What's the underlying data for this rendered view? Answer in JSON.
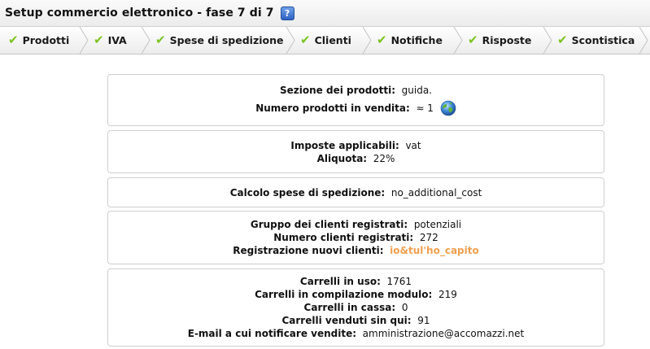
{
  "window": {
    "title": "Setup commercio elettronico - fase 7 di 7",
    "help_icon": "question-icon"
  },
  "steps": [
    {
      "label": "Prodotti",
      "icon": "check-icon"
    },
    {
      "label": "IVA",
      "icon": "check-icon"
    },
    {
      "label": "Spese di spedizione",
      "icon": "check-icon"
    },
    {
      "label": "Clienti",
      "icon": "check-icon"
    },
    {
      "label": "Notifiche",
      "icon": "check-icon"
    },
    {
      "label": "Risposte",
      "icon": "check-icon"
    },
    {
      "label": "Scontistica",
      "icon": "check-icon"
    }
  ],
  "products": {
    "section_label": "Sezione dei prodotti:",
    "section_value": "guida.",
    "count_label": "Numero prodotti in vendita:",
    "count_value": "≈ 1",
    "count_icon": "globe-icon"
  },
  "vat": {
    "taxes_label": "Imposte applicabili:",
    "taxes_value": "vat",
    "rate_label": "Aliquota:",
    "rate_value": "22%"
  },
  "shipping": {
    "calc_label": "Calcolo spese di spedizione:",
    "calc_value": "no_additional_cost"
  },
  "customers": {
    "group_label": "Gruppo dei clienti registrati:",
    "group_value": "potenziali",
    "count_label": "Numero clienti registrati:",
    "count_value": "272",
    "registration_label": "Registrazione nuovi clienti:",
    "registration_value": "io&tul'ho_capito"
  },
  "carts": {
    "in_use_label": "Carrelli in uso:",
    "in_use_value": "1761",
    "filling_label": "Carrelli in compilazione modulo:",
    "filling_value": "219",
    "checkout_label": "Carrelli in cassa:",
    "checkout_value": "0",
    "sold_label": "Carrelli venduti sin qui:",
    "sold_value": "91",
    "email_label": "E-mail a cui notificare vendite:",
    "email_value": "amministrazione@accomazzi.net"
  },
  "colors": {
    "check": "#7cc421",
    "link": "#f0a050",
    "help": "#2f63c2"
  }
}
